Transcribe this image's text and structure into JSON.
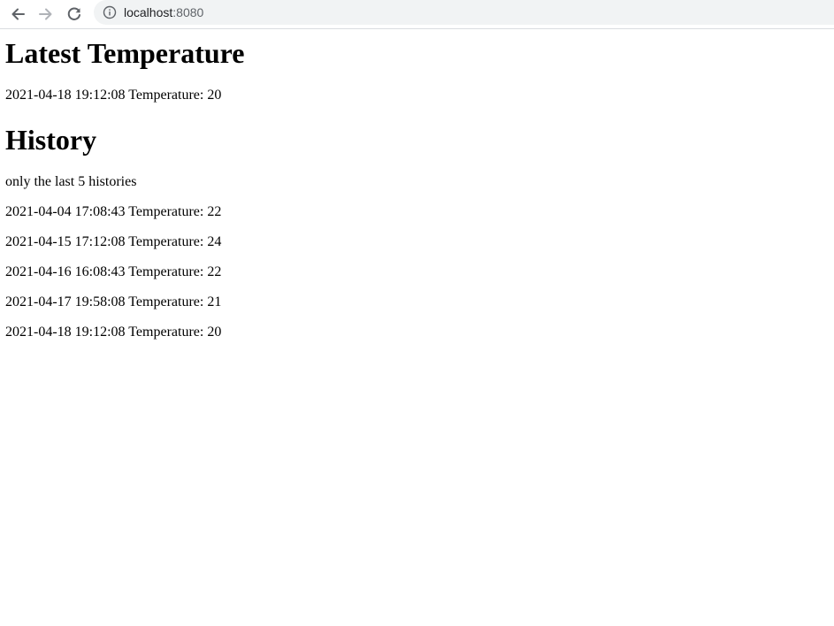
{
  "browser": {
    "url_host": "localhost",
    "url_port": ":8080",
    "icons": {
      "back": "back-arrow-icon",
      "forward": "forward-arrow-icon",
      "reload": "reload-icon",
      "info": "info-icon"
    },
    "colors": {
      "icon_active": "#5f6368",
      "icon_disabled": "#b0b3b8",
      "omnibox_bg": "#f1f3f4"
    }
  },
  "latest": {
    "heading": "Latest Temperature",
    "reading": "2021-04-18 19:12:08 Temperature: 20"
  },
  "history": {
    "heading": "History",
    "note": "only the last 5 histories",
    "entries": [
      "2021-04-04 17:08:43 Temperature: 22",
      "2021-04-15 17:12:08 Temperature: 24",
      "2021-04-16 16:08:43 Temperature: 22",
      "2021-04-17 19:58:08 Temperature: 21",
      "2021-04-18 19:12:08 Temperature: 20"
    ]
  }
}
